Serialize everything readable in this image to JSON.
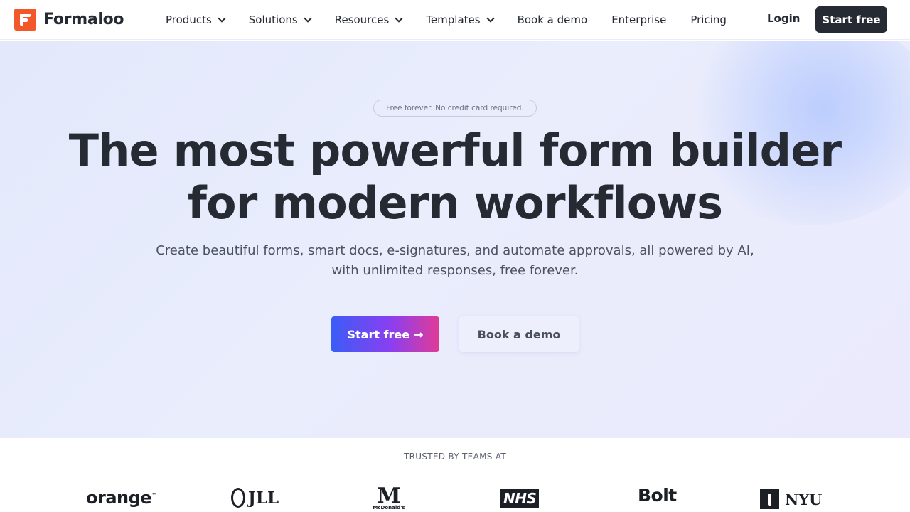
{
  "nav": {
    "logo_text": "Formaloo",
    "menu": [
      {
        "label": "Products",
        "dropdown": true
      },
      {
        "label": "Solutions",
        "dropdown": true
      },
      {
        "label": "Resources",
        "dropdown": true
      },
      {
        "label": "Templates",
        "dropdown": true
      },
      {
        "label": "Book a demo",
        "dropdown": false
      },
      {
        "label": "Enterprise",
        "dropdown": false
      },
      {
        "label": "Pricing",
        "dropdown": false
      }
    ],
    "login_label": "Login",
    "cta_label": "Start free"
  },
  "hero": {
    "badge": "Free forever. No credit card required.",
    "headline_line1": "The most powerful form builder",
    "headline_line2": "for modern workflows",
    "subtitle": "Create beautiful forms, smart docs, e-signatures, and automate approvals, all powered by AI, with unlimited responses, free forever.",
    "primary_label": "Start free",
    "primary_arrow": "→",
    "secondary_label": "Book a demo"
  },
  "trusted": {
    "label": "TRUSTED BY TEAMS AT",
    "logos": {
      "orange": "orange",
      "orange_tm": "™",
      "jll": "JLL",
      "mcdonalds_mark": "M",
      "mcdonalds": "McDonald's",
      "nhs": "NHS",
      "bolt": "Bolt",
      "nyu": "NYU"
    }
  },
  "colors": {
    "brand_orange": "#f2582a",
    "dark": "#262b33",
    "gradient_start": "#3b5cf6",
    "gradient_end": "#e03b97"
  }
}
